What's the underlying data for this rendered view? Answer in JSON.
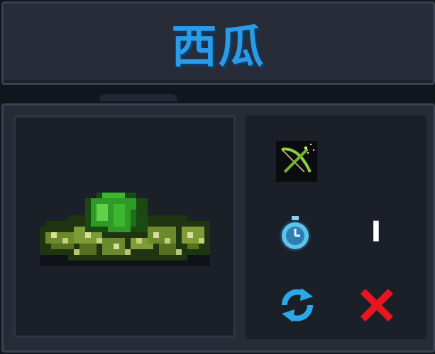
{
  "title": "西瓜",
  "item": {
    "icon": "watermelon-sprout-icon"
  },
  "stats": {
    "weapon_icon": "bow-icon",
    "timer_icon": "stopwatch-icon",
    "time_value": "I"
  },
  "actions": {
    "refresh_icon": "refresh-icon",
    "close_icon": "close-icon"
  },
  "colors": {
    "title": "#2a9be8",
    "close": "#e8141e",
    "refresh": "#2aa8e8"
  }
}
